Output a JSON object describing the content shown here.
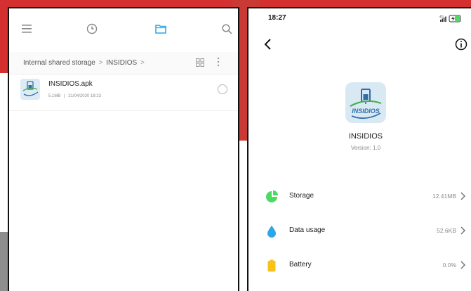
{
  "file_manager": {
    "breadcrumb": [
      "Internal shared storage",
      "INSIDIOS"
    ],
    "files": [
      {
        "name": "INSIDIOS.apk",
        "size": "5.1MB",
        "date": "21/04/2020 18:23"
      }
    ]
  },
  "app_info": {
    "status_time": "18:27",
    "status_network": "4G",
    "app_icon_text": "INSIDIOS",
    "app_name": "INSIDIOS",
    "version": "Version: 1.0",
    "rows": [
      {
        "label": "Storage",
        "value": "12.41MB",
        "icon": "pie-chart-icon",
        "color": "#4cd964"
      },
      {
        "label": "Data usage",
        "value": "52.6KB",
        "icon": "droplet-icon",
        "color": "#2aa7e8"
      },
      {
        "label": "Battery",
        "value": "0.0%",
        "icon": "battery-icon",
        "color": "#f7c31b"
      }
    ]
  },
  "colors": {
    "accent_blue": "#2aa7e8",
    "background_red": "#d3302f"
  }
}
